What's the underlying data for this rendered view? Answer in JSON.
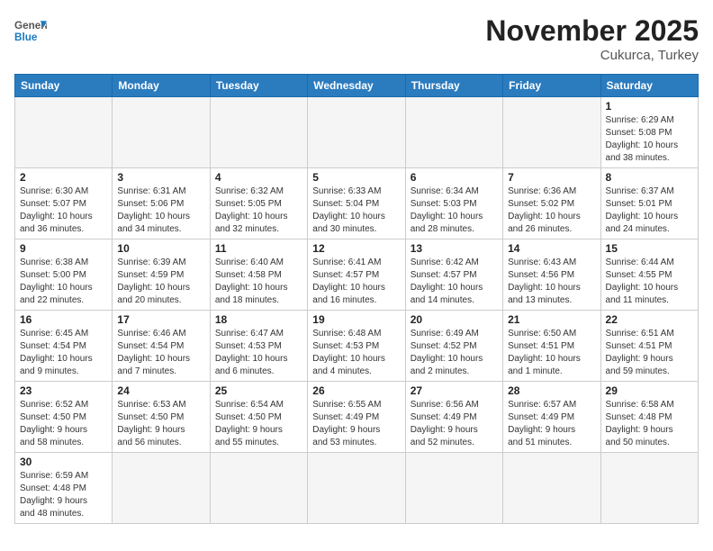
{
  "header": {
    "logo_general": "General",
    "logo_blue": "Blue",
    "month_title": "November 2025",
    "location": "Cukurca, Turkey"
  },
  "weekdays": [
    "Sunday",
    "Monday",
    "Tuesday",
    "Wednesday",
    "Thursday",
    "Friday",
    "Saturday"
  ],
  "weeks": [
    [
      {
        "day": "",
        "info": ""
      },
      {
        "day": "",
        "info": ""
      },
      {
        "day": "",
        "info": ""
      },
      {
        "day": "",
        "info": ""
      },
      {
        "day": "",
        "info": ""
      },
      {
        "day": "",
        "info": ""
      },
      {
        "day": "1",
        "info": "Sunrise: 6:29 AM\nSunset: 5:08 PM\nDaylight: 10 hours\nand 38 minutes."
      }
    ],
    [
      {
        "day": "2",
        "info": "Sunrise: 6:30 AM\nSunset: 5:07 PM\nDaylight: 10 hours\nand 36 minutes."
      },
      {
        "day": "3",
        "info": "Sunrise: 6:31 AM\nSunset: 5:06 PM\nDaylight: 10 hours\nand 34 minutes."
      },
      {
        "day": "4",
        "info": "Sunrise: 6:32 AM\nSunset: 5:05 PM\nDaylight: 10 hours\nand 32 minutes."
      },
      {
        "day": "5",
        "info": "Sunrise: 6:33 AM\nSunset: 5:04 PM\nDaylight: 10 hours\nand 30 minutes."
      },
      {
        "day": "6",
        "info": "Sunrise: 6:34 AM\nSunset: 5:03 PM\nDaylight: 10 hours\nand 28 minutes."
      },
      {
        "day": "7",
        "info": "Sunrise: 6:36 AM\nSunset: 5:02 PM\nDaylight: 10 hours\nand 26 minutes."
      },
      {
        "day": "8",
        "info": "Sunrise: 6:37 AM\nSunset: 5:01 PM\nDaylight: 10 hours\nand 24 minutes."
      }
    ],
    [
      {
        "day": "9",
        "info": "Sunrise: 6:38 AM\nSunset: 5:00 PM\nDaylight: 10 hours\nand 22 minutes."
      },
      {
        "day": "10",
        "info": "Sunrise: 6:39 AM\nSunset: 4:59 PM\nDaylight: 10 hours\nand 20 minutes."
      },
      {
        "day": "11",
        "info": "Sunrise: 6:40 AM\nSunset: 4:58 PM\nDaylight: 10 hours\nand 18 minutes."
      },
      {
        "day": "12",
        "info": "Sunrise: 6:41 AM\nSunset: 4:57 PM\nDaylight: 10 hours\nand 16 minutes."
      },
      {
        "day": "13",
        "info": "Sunrise: 6:42 AM\nSunset: 4:57 PM\nDaylight: 10 hours\nand 14 minutes."
      },
      {
        "day": "14",
        "info": "Sunrise: 6:43 AM\nSunset: 4:56 PM\nDaylight: 10 hours\nand 13 minutes."
      },
      {
        "day": "15",
        "info": "Sunrise: 6:44 AM\nSunset: 4:55 PM\nDaylight: 10 hours\nand 11 minutes."
      }
    ],
    [
      {
        "day": "16",
        "info": "Sunrise: 6:45 AM\nSunset: 4:54 PM\nDaylight: 10 hours\nand 9 minutes."
      },
      {
        "day": "17",
        "info": "Sunrise: 6:46 AM\nSunset: 4:54 PM\nDaylight: 10 hours\nand 7 minutes."
      },
      {
        "day": "18",
        "info": "Sunrise: 6:47 AM\nSunset: 4:53 PM\nDaylight: 10 hours\nand 6 minutes."
      },
      {
        "day": "19",
        "info": "Sunrise: 6:48 AM\nSunset: 4:53 PM\nDaylight: 10 hours\nand 4 minutes."
      },
      {
        "day": "20",
        "info": "Sunrise: 6:49 AM\nSunset: 4:52 PM\nDaylight: 10 hours\nand 2 minutes."
      },
      {
        "day": "21",
        "info": "Sunrise: 6:50 AM\nSunset: 4:51 PM\nDaylight: 10 hours\nand 1 minute."
      },
      {
        "day": "22",
        "info": "Sunrise: 6:51 AM\nSunset: 4:51 PM\nDaylight: 9 hours\nand 59 minutes."
      }
    ],
    [
      {
        "day": "23",
        "info": "Sunrise: 6:52 AM\nSunset: 4:50 PM\nDaylight: 9 hours\nand 58 minutes."
      },
      {
        "day": "24",
        "info": "Sunrise: 6:53 AM\nSunset: 4:50 PM\nDaylight: 9 hours\nand 56 minutes."
      },
      {
        "day": "25",
        "info": "Sunrise: 6:54 AM\nSunset: 4:50 PM\nDaylight: 9 hours\nand 55 minutes."
      },
      {
        "day": "26",
        "info": "Sunrise: 6:55 AM\nSunset: 4:49 PM\nDaylight: 9 hours\nand 53 minutes."
      },
      {
        "day": "27",
        "info": "Sunrise: 6:56 AM\nSunset: 4:49 PM\nDaylight: 9 hours\nand 52 minutes."
      },
      {
        "day": "28",
        "info": "Sunrise: 6:57 AM\nSunset: 4:49 PM\nDaylight: 9 hours\nand 51 minutes."
      },
      {
        "day": "29",
        "info": "Sunrise: 6:58 AM\nSunset: 4:48 PM\nDaylight: 9 hours\nand 50 minutes."
      }
    ],
    [
      {
        "day": "30",
        "info": "Sunrise: 6:59 AM\nSunset: 4:48 PM\nDaylight: 9 hours\nand 48 minutes."
      },
      {
        "day": "",
        "info": ""
      },
      {
        "day": "",
        "info": ""
      },
      {
        "day": "",
        "info": ""
      },
      {
        "day": "",
        "info": ""
      },
      {
        "day": "",
        "info": ""
      },
      {
        "day": "",
        "info": ""
      }
    ]
  ]
}
